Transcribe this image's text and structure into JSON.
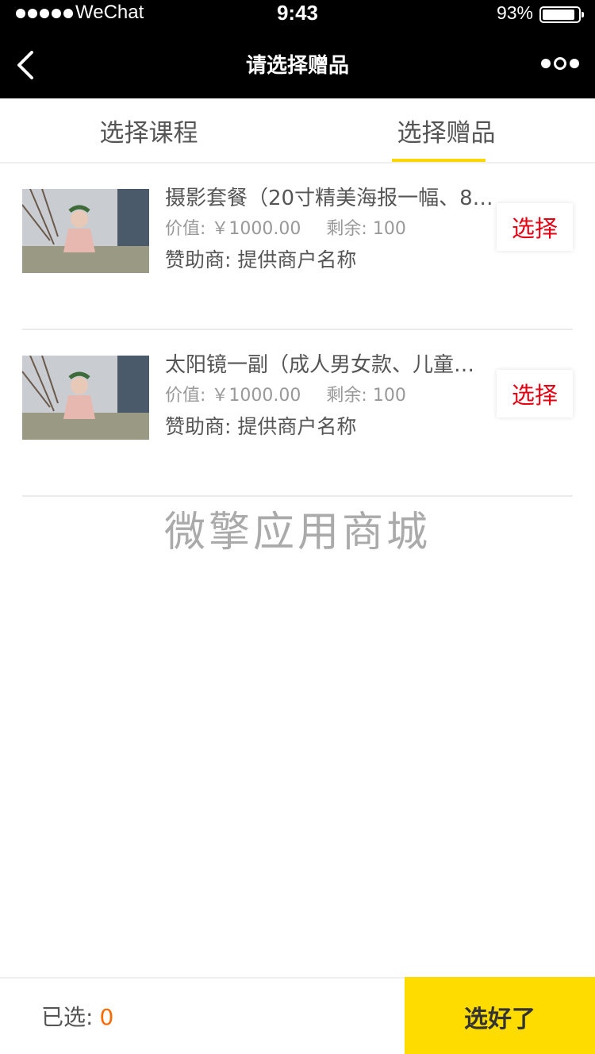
{
  "status_bar": {
    "carrier": "WeChat",
    "time": "9:43",
    "battery": "93%"
  },
  "nav": {
    "title": "请选择赠品"
  },
  "tabs": [
    {
      "label": "选择课程",
      "active": false
    },
    {
      "label": "选择赠品",
      "active": true
    }
  ],
  "gifts": [
    {
      "name": "摄影套餐（20寸精美海报一幅、8…",
      "value_label": "价值:",
      "value": "￥1000.00",
      "remaining_label": "剩余:",
      "remaining": "100",
      "sponsor_label": "赞助商:",
      "sponsor": "提供商户名称",
      "action": "选择"
    },
    {
      "name": "太阳镜一副（成人男女款、儿童…",
      "value_label": "价值:",
      "value": "￥1000.00",
      "remaining_label": "剩余:",
      "remaining": "100",
      "sponsor_label": "赞助商:",
      "sponsor": "提供商户名称",
      "action": "选择"
    }
  ],
  "brand": "微擎应用商城",
  "footer": {
    "selected_label": "已选:",
    "selected_count": "0",
    "confirm": "选好了"
  },
  "colors": {
    "accent": "#ffdc00",
    "action_text": "#e60012",
    "count": "#ff6a00"
  }
}
